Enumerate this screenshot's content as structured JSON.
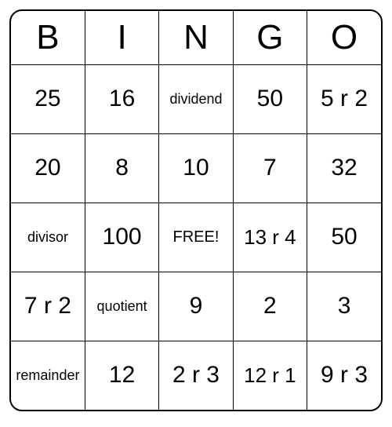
{
  "headers": [
    "B",
    "I",
    "N",
    "G",
    "O"
  ],
  "rows": [
    [
      {
        "text": "25",
        "cls": ""
      },
      {
        "text": "16",
        "cls": ""
      },
      {
        "text": "dividend",
        "cls": "small"
      },
      {
        "text": "50",
        "cls": ""
      },
      {
        "text": "5 r 2",
        "cls": ""
      }
    ],
    [
      {
        "text": "20",
        "cls": ""
      },
      {
        "text": "8",
        "cls": ""
      },
      {
        "text": "10",
        "cls": ""
      },
      {
        "text": "7",
        "cls": ""
      },
      {
        "text": "32",
        "cls": ""
      }
    ],
    [
      {
        "text": "divisor",
        "cls": "small"
      },
      {
        "text": "100",
        "cls": ""
      },
      {
        "text": "FREE!",
        "cls": "free"
      },
      {
        "text": "13 r 4",
        "cls": "multi"
      },
      {
        "text": "50",
        "cls": ""
      }
    ],
    [
      {
        "text": "7 r 2",
        "cls": ""
      },
      {
        "text": "quotient",
        "cls": "small"
      },
      {
        "text": "9",
        "cls": ""
      },
      {
        "text": "2",
        "cls": ""
      },
      {
        "text": "3",
        "cls": ""
      }
    ],
    [
      {
        "text": "remainder",
        "cls": "small"
      },
      {
        "text": "12",
        "cls": ""
      },
      {
        "text": "2 r 3",
        "cls": ""
      },
      {
        "text": "12 r 1",
        "cls": "multi"
      },
      {
        "text": "9 r 3",
        "cls": ""
      }
    ]
  ]
}
